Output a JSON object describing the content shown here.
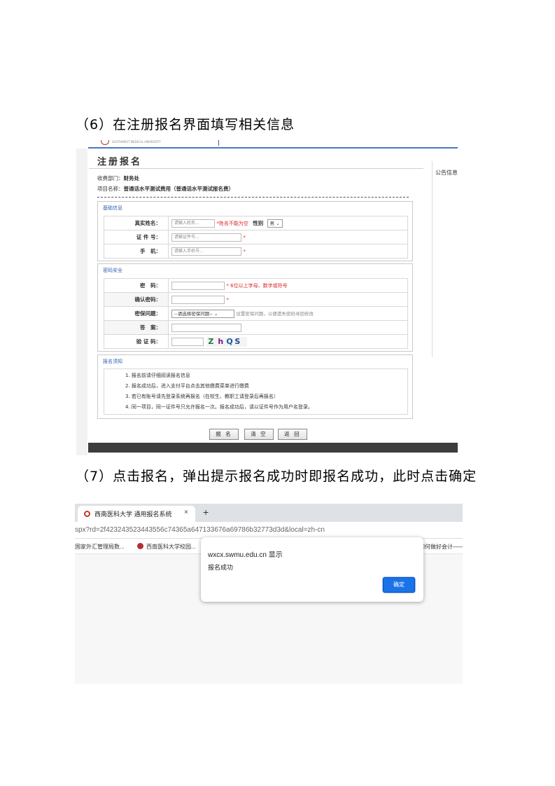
{
  "step6": {
    "heading": "（6）在注册报名界面填写相关信息"
  },
  "form": {
    "logo_text": "SOUTHWEST MEDICAL UNIVERSITY",
    "title": "注册报名",
    "right_panel_label": "公告信息",
    "dept_label": "收费部门：",
    "dept_value": "财务处",
    "project_label": "项目名称：",
    "project_value": "普通话水平测试费用（普通话水平测试报名费）",
    "basic": {
      "legend": "基础信息",
      "name_label": "真实姓名：",
      "name_placeholder": "请输入姓名...",
      "name_hint": "*姓名不能为空",
      "gender_label": "性别",
      "gender_value": "男",
      "id_label": "证 件 号：",
      "id_placeholder": "请输证件号...",
      "phone_label": "手　机：",
      "phone_placeholder": "请输入手机号...",
      "required_mark": "*"
    },
    "security": {
      "legend": "密码安全",
      "password_label": "密　码：",
      "password_hint": "* 6位以上字母、数字或符号",
      "confirm_label": "确认密码：",
      "question_label": "密保问题：",
      "question_value": "--请选择密保问题--",
      "question_hint": "设置密保问题，以便遗失密码寻回修改",
      "answer_label": "答　案：",
      "captcha_label": "验 证 码：",
      "captcha_chars": [
        "Z",
        "h",
        "Q",
        "S"
      ],
      "required_mark": "*"
    },
    "notice": {
      "legend": "报名须知",
      "items": [
        "1. 报名前请仔细阅读报名信息",
        "2. 报名成功后，进入支付平台点击其他缴费菜单进行缴费",
        "3. 若已有账号请先登录系统再报名（在校生、教职工请登录后再报名）",
        "4. 同一项目，同一证件号只允许报名一次。报名成功后，请以证件号作为用户名登录。"
      ]
    },
    "buttons": {
      "submit": "报 名",
      "clear": "清 空",
      "back": "返 回"
    }
  },
  "step7": {
    "heading": "（7）点击报名，弹出提示报名成功时即报名成功，此时点击确定"
  },
  "browser": {
    "tab_title": "西南医科大学 通用报名系统",
    "tab_close": "×",
    "new_tab": "+",
    "url": "spx?rd=2f423243523443556c74365a647133676a69786b32773d3d&local=zh-cn",
    "bookmarks": [
      "国家外汇管理局数...",
      "西南医科大学校园...",
      "如何做好会计——..."
    ],
    "dialog": {
      "title": "wxcx.swmu.edu.cn 显示",
      "message": "报名成功",
      "ok": "确定"
    }
  },
  "colors": {
    "accent_blue": "#1a73e8",
    "required_red": "#d22",
    "legend_blue": "#3463b3"
  }
}
